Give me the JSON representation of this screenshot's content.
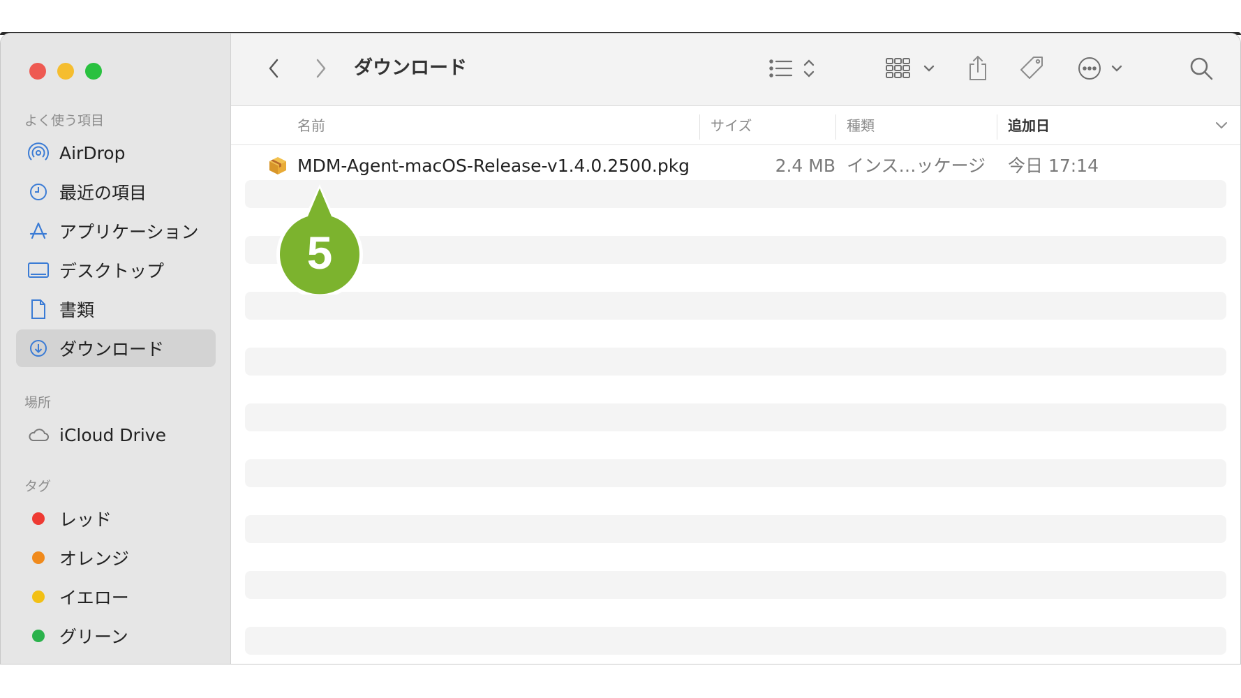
{
  "window": {
    "title": "ダウンロード"
  },
  "sidebar": {
    "favorites_heading": "よく使う項目",
    "favorites": [
      {
        "label": "AirDrop",
        "icon": "airdrop-icon"
      },
      {
        "label": "最近の項目",
        "icon": "clock-icon"
      },
      {
        "label": "アプリケーション",
        "icon": "applications-icon"
      },
      {
        "label": "デスクトップ",
        "icon": "desktop-icon"
      },
      {
        "label": "書類",
        "icon": "document-icon"
      },
      {
        "label": "ダウンロード",
        "icon": "downloads-icon",
        "selected": true
      }
    ],
    "locations_heading": "場所",
    "locations": [
      {
        "label": "iCloud Drive",
        "icon": "cloud-icon"
      }
    ],
    "tags_heading": "タグ",
    "tags": [
      {
        "label": "レッド",
        "color": "#ee3a33"
      },
      {
        "label": "オレンジ",
        "color": "#f08a1c"
      },
      {
        "label": "イエロー",
        "color": "#f2c015"
      },
      {
        "label": "グリーン",
        "color": "#2bb24c"
      }
    ]
  },
  "columns": {
    "name": "名前",
    "size": "サイズ",
    "kind": "種類",
    "date_added": "追加日"
  },
  "files": [
    {
      "name": "MDM-Agent-macOS-Release-v1.4.0.2500.pkg",
      "size": "2.4 MB",
      "kind": "インス…ッケージ",
      "date_added": "今日 17:14",
      "icon": "package-icon"
    }
  ],
  "callout": {
    "number": "5",
    "color": "#7cb32e"
  }
}
